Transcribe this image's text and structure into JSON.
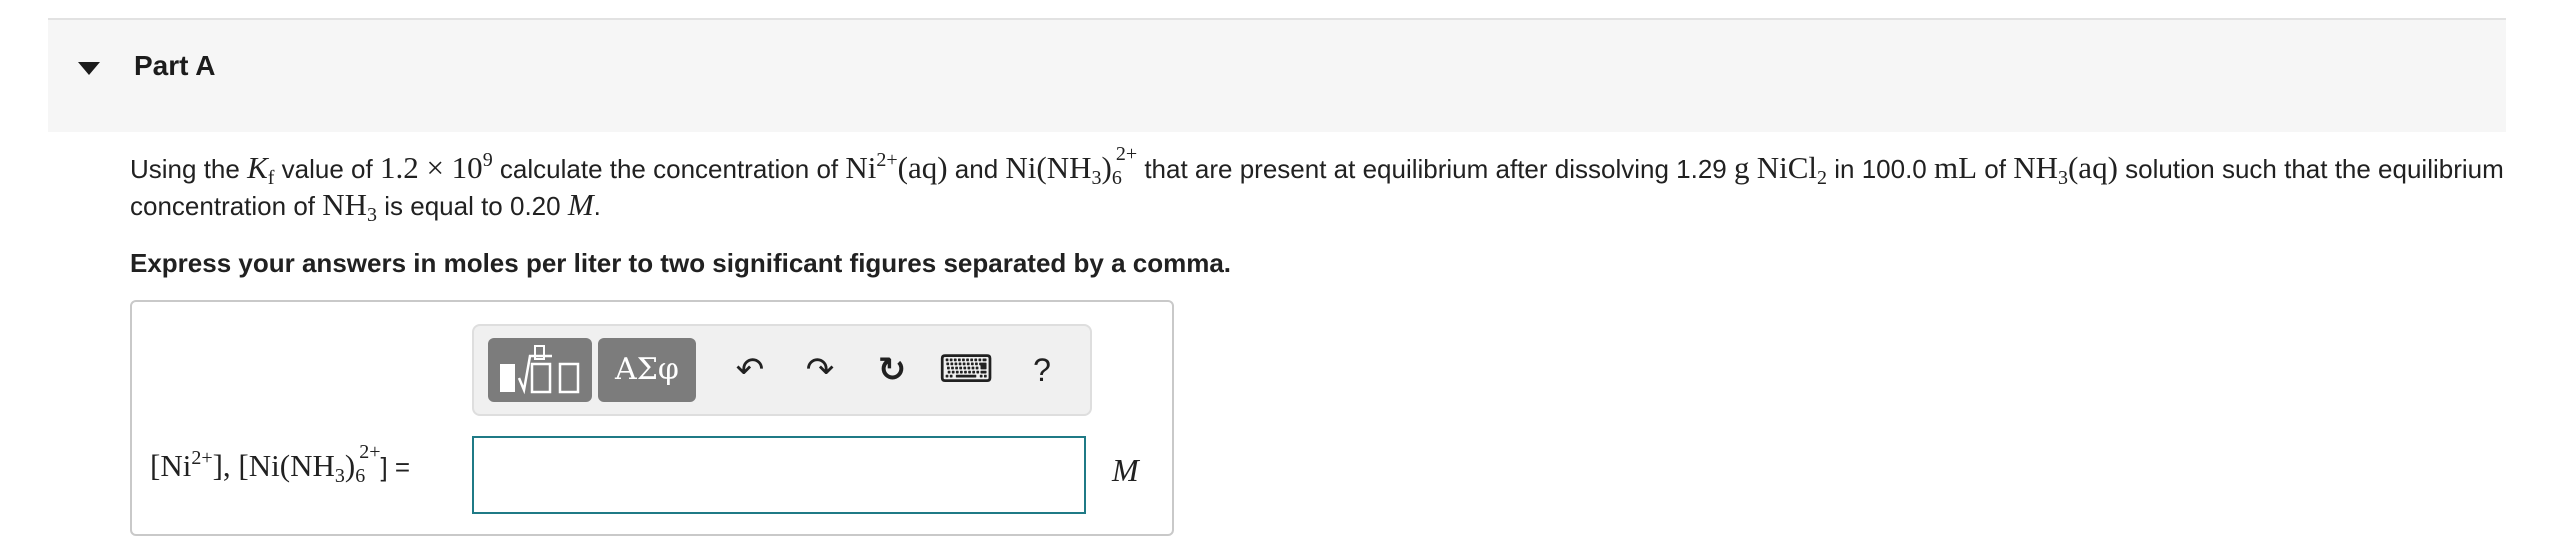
{
  "part": {
    "title": "Part A"
  },
  "problem": {
    "t_using": "Using the ",
    "kf_k": "K",
    "kf_sub": "f",
    "t_value_of": " value of ",
    "kf_value": "1.2 × 10",
    "kf_exp": "9",
    "t_calc": " calculate the concentration of ",
    "ni_ion": "Ni",
    "ni_charge": "2+",
    "aq1": "(aq)",
    "t_and": " and ",
    "complex_a": "Ni(NH",
    "complex_sub3": "3",
    "complex_b": ")",
    "complex_sub6": "6",
    "complex_charge": "2+",
    "t_present": " that are present at equilibrium after dissolving 1.29 ",
    "unit_g": "g",
    "nicl": "NiCl",
    "nicl_sub": "2",
    "t_in": " in 100.0 ",
    "unit_ml": "mL",
    "t_of": " of ",
    "nh": "NH",
    "nh_sub": "3",
    "aq2": "(aq)",
    "t_solution": " solution such that the equilibrium concentration of ",
    "nh2": "NH",
    "nh2_sub": "3",
    "t_equal": " is equal to 0.20 ",
    "unit_M": "M",
    "period": "."
  },
  "instruction": "Express your answers in moles per liter to two significant figures separated by a comma.",
  "toolbar": {
    "greek_label": "ΑΣφ",
    "undo_icon": "↶",
    "redo_icon": "↷",
    "reset_icon": "↻",
    "keyboard_icon": "⌨",
    "help_label": "?"
  },
  "answer": {
    "lb1": "[Ni",
    "lb1_sup": "2+",
    "lb1_close": "], [Ni(NH",
    "lb_sub3": "3",
    "lb_paren": ")",
    "lb_sub6": "6",
    "lb_sup": "2+",
    "lb_close": "] =",
    "value": "",
    "unit": "M"
  },
  "colors": {
    "input_border": "#1f7a86",
    "toolbar_button": "#7c7c7c",
    "header_bg": "#f6f6f6"
  }
}
